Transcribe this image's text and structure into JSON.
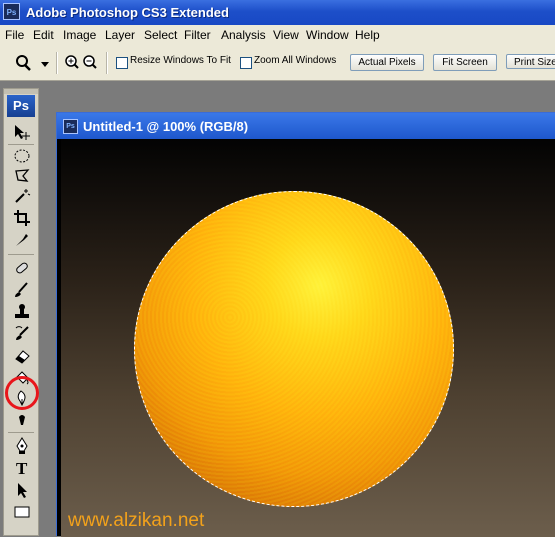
{
  "window": {
    "title": "Adobe Photoshop CS3 Extended",
    "app_icon": "Ps"
  },
  "menu": [
    "File",
    "Edit",
    "Image",
    "Layer",
    "Select",
    "Filter",
    "Analysis",
    "View",
    "Window",
    "Help"
  ],
  "options": {
    "resize_windows_label": "Resize Windows To Fit",
    "zoom_all_label": "Zoom All Windows",
    "actual_pixels": "Actual Pixels",
    "fit_screen": "Fit Screen",
    "print_size": "Print Size"
  },
  "toolbox": {
    "logo": "Ps",
    "tools": [
      "move",
      "marquee",
      "lasso",
      "magic-wand",
      "crop",
      "slice",
      "healing-brush",
      "brush",
      "clone-stamp",
      "history-brush",
      "eraser",
      "paint-bucket",
      "burn",
      "sponge",
      "pen",
      "type",
      "path-selection",
      "rectangle"
    ],
    "highlighted_tool": "burn"
  },
  "document": {
    "title": "Untitled-1 @ 100% (RGB/8)",
    "icon": "Ps"
  },
  "watermark": "www.alzikan.net",
  "colors": {
    "sphere": "#ffb40c",
    "highlight_ring": "#e8161b",
    "title_bar": "#1d4fc9"
  }
}
